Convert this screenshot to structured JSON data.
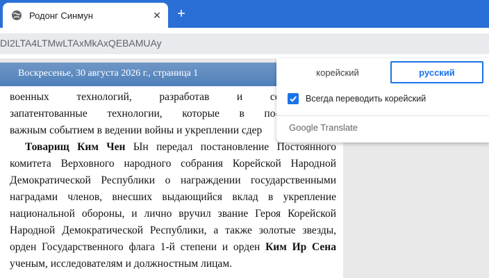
{
  "tab": {
    "title": "Родонг Синмун",
    "favicon": "globe-icon",
    "close": "✕",
    "new_tab": "+"
  },
  "address": {
    "url": "DI2LTA4LTMwLTAxMkAxQEBAMUAy"
  },
  "document": {
    "header": "Воскресенье, 30 августа 2026 г., страница 1",
    "lines": [
      "военных технологий, разработав и создав за",
      "запатентованные технологии, которые в последнее в",
      "важным событием в ведении войны и укреплении сдер"
    ],
    "para2": {
      "bold_name": "Товарищ Ким Чен",
      "first_rest": " Ын передал постановление Постоянного",
      "lines": [
        "комитета Верховного народного собрания Корейской Народной",
        "Демократической Республики о награждении государственными",
        "наградами членов, внесших выдающийся вклад в укрепление",
        "национальной обороны, и лично вручил звание Героя Корейской",
        "Народной Демократической Республики, а также золотые звезды,"
      ],
      "order_line_start": "орден Государственного флага 1-й степени и орден ",
      "order_bold": "Ким Ир Сена",
      "last_line": "ученым, исследователям и должностным лицам."
    }
  },
  "translate": {
    "source_lang": "корейский",
    "target_lang": "русский",
    "always_label": "Всегда переводить корейский",
    "always_checked": true,
    "brand": "Google Translate"
  },
  "colors": {
    "tab_strip": "#2a6fd6",
    "accent": "#1a73e8",
    "doc_header": "#5a88c0"
  }
}
